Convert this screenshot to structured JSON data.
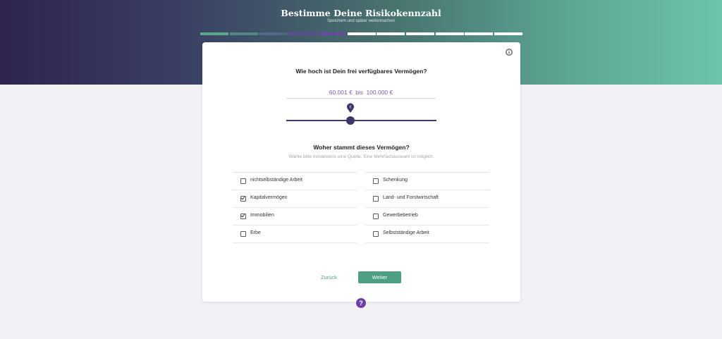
{
  "header": {
    "title": "Bestimme Deine Risikokennzahl",
    "subtitle": "Speichern und später weitermachen"
  },
  "progress": {
    "total_steps": 11,
    "completed_steps": 5,
    "segment_colors": [
      "#5aa88c",
      "#4f8686",
      "#4f6a86",
      "#5b4e93",
      "#6a4c9f",
      "#ffffff",
      "#ffffff",
      "#ffffff",
      "#ffffff",
      "#ffffff",
      "#ffffff"
    ]
  },
  "question1": {
    "text": "Wie hoch ist Dein frei verfügbares Vermögen?",
    "range_from": "60.001 €",
    "range_sep": "bis",
    "range_to": "100.000 €",
    "slider_pin": "€"
  },
  "question2": {
    "text": "Woher stammt dieses Vermögen?",
    "hint": "Wähle bitte mindestens eine Quelle. Eine Mehrfachauswahl ist möglich."
  },
  "options": {
    "left": [
      {
        "label": "nichtselbständige Arbeit",
        "checked": false
      },
      {
        "label": "Kapitalvermögen",
        "checked": true
      },
      {
        "label": "Immobilien",
        "checked": true
      },
      {
        "label": "Erbe",
        "checked": false
      }
    ],
    "right": [
      {
        "label": "Schenkung",
        "checked": false
      },
      {
        "label": "Land- und Forstwirtschaft",
        "checked": false
      },
      {
        "label": "Gewerbebetrieb",
        "checked": false
      },
      {
        "label": "Selbstständige Arbeit",
        "checked": false
      }
    ]
  },
  "nav": {
    "back_label": "Zurück",
    "next_label": "Weiter"
  },
  "help": {
    "label": "?"
  },
  "icons": {
    "info": "info-icon",
    "pin": "location-pin-icon",
    "checkbox": "checkbox-icon"
  },
  "colors": {
    "accent_green": "#4e9f82",
    "accent_purple": "#6d3fa8",
    "slider": "#3f3a6a",
    "range_text": "#7c5da6"
  }
}
